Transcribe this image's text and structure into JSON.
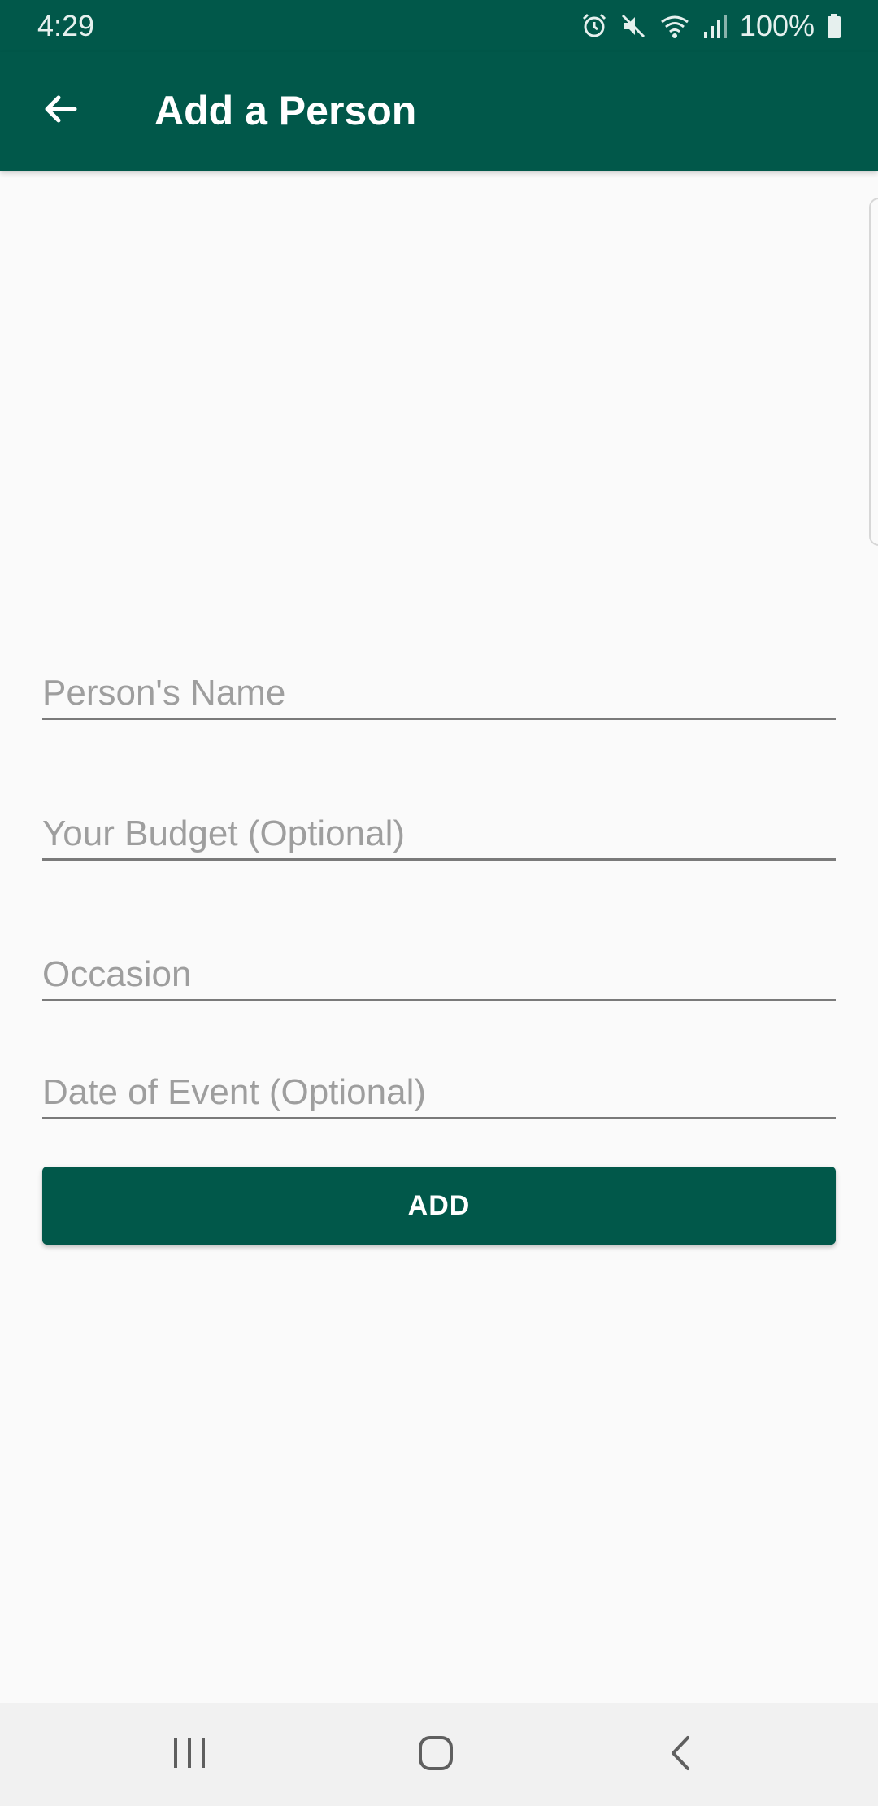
{
  "status_bar": {
    "time": "4:29",
    "battery": "100%",
    "icons": [
      "alarm-icon",
      "mute-icon",
      "wifi-icon",
      "signal-icon",
      "battery-icon"
    ]
  },
  "app_bar": {
    "title": "Add a Person",
    "back_icon": "arrow-back-icon"
  },
  "form": {
    "name_placeholder": "Person's Name",
    "budget_placeholder": "Your Budget (Optional)",
    "occasion_placeholder": "Occasion",
    "date_placeholder": "Date of Event (Optional)",
    "name_value": "",
    "budget_value": "",
    "occasion_value": "",
    "date_value": "",
    "add_label": "ADD"
  },
  "nav_bar": {
    "icons": [
      "recent-apps-icon",
      "home-icon",
      "back-icon"
    ]
  },
  "colors": {
    "primary": "#01584a",
    "background": "#fafafa",
    "hint_text": "#9e9e9e",
    "underline": "#7a7a7a"
  }
}
